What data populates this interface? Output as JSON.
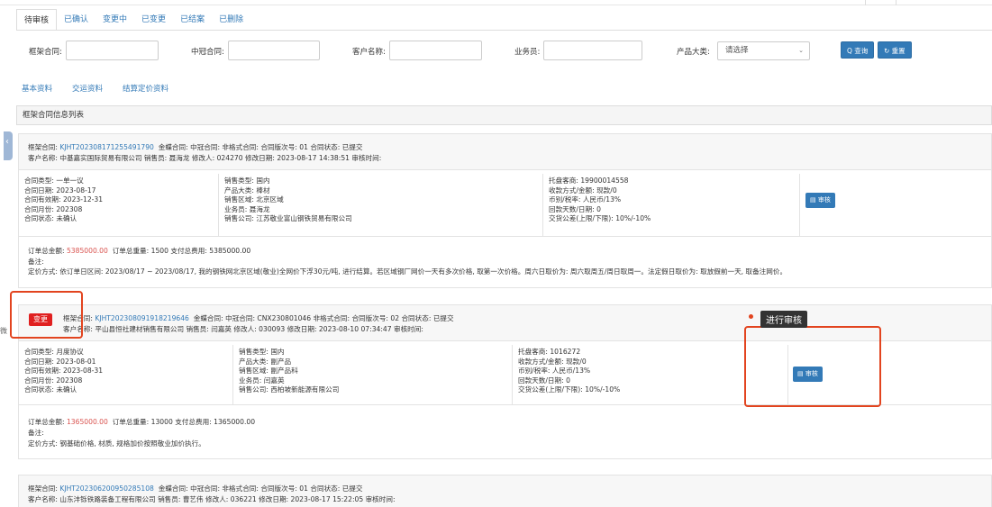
{
  "tabs": [
    "待审核",
    "已确认",
    "变更中",
    "已变更",
    "已结案",
    "已删除"
  ],
  "search": {
    "frame_label": "框架合同:",
    "zg_label": "中冠合同:",
    "customer_label": "客户名称:",
    "salesman_label": "业务员:",
    "category_label": "产品大类:",
    "category_value": "请选择",
    "query_label": "Q 查询",
    "reset_label": "↻ 重置"
  },
  "subtabs": [
    "基本资料",
    "交运资料",
    "结算定价资料"
  ],
  "panel_title": "框架合同信息列表",
  "side_char": "微",
  "tooltip": "进行审核",
  "badge": "变更",
  "audit_label": "审核",
  "contracts": [
    {
      "head1_pre": "框架合同:",
      "frame_no": "KJHT202308171255491790",
      "head1_rest": "金蝶合同:    中冠合同:    非格式合同:    合同版次号: 01   合同状态: 已提交",
      "head2": "客户名称: 中基嘉实国际贸易有限公司   销售员: 聂海龙   修改人: 024270   修改日期: 2023-08-17 14:38:51   审核时间:",
      "col1": [
        "合同类型: 一单一议",
        "合同日期: 2023-08-17",
        "合同有效期: 2023-12-31",
        "合同月份: 202308",
        "合同状态: 未确认"
      ],
      "col2": [
        "销售类型: 国内",
        "产品大类: 棒材",
        "销售区域: 北京区域",
        "业务员: 聂海龙",
        "销售公司: 江苏敬业富山钢铁贸易有限公司"
      ],
      "col3": [
        "托盘客商: 19900014558",
        "收款方式/金额: 现款/0",
        "币别/税率: 人民币/13%",
        "回款天数/日期: 0",
        "交货公差(上限/下限): 10%/-10%"
      ],
      "amount_label": "订单总金额:",
      "amount": "5385000.00",
      "amount_rest": "订单总重量: 1500   支付总费用: 5385000.00",
      "remark": "备注:",
      "pricing": "定价方式: 依订单日区间: 2023/08/17 ~ 2023/08/17, 我的钢铁网北京区域(敬业)全网价下浮30元/吨, 进行结算。若区域钢厂网价一天有多次价格, 取第一次价格。周六日取价为: 周六取周五/周日取周一。法定假日取价为: 取放假前一天, 取备注网价。"
    },
    {
      "head1_pre": "框架合同:",
      "frame_no": "KJHT202308091918219646",
      "head1_rest": "金蝶合同:    中冠合同: CNX230801046   非格式合同:    合同版次号: 02   合同状态: 已提交",
      "head2": "客户名称: 平山县恒社建材销售有限公司   销售员: 闫嘉英   修改人: 030093   修改日期: 2023-08-10 07:34:47   审核时间:",
      "col1": [
        "合同类型: 月度协议",
        "合同日期: 2023-08-01",
        "合同有效期: 2023-08-31",
        "合同月份: 202308",
        "合同状态: 未确认"
      ],
      "col2": [
        "销售类型: 国内",
        "产品大类: 副产品",
        "销售区域: 副产品科",
        "业务员: 闫嘉英",
        "销售公司: 西柏坡新能源有限公司"
      ],
      "col3": [
        "托盘客商: 1016272",
        "收款方式/金额: 现款/0",
        "币别/税率: 人民币/13%",
        "回款天数/日期: 0",
        "交货公差(上限/下限): 10%/-10%"
      ],
      "amount_label": "订单总金额:",
      "amount": "1365000.00",
      "amount_rest": "订单总重量: 13000   支付总费用: 1365000.00",
      "remark": "备注:",
      "pricing": "定价方式: 钢基础价格, 材质, 规格加价按照敬业加价执行。"
    },
    {
      "head1_pre": "框架合同:",
      "frame_no": "KJHT202306200950285108",
      "head1_rest": "金蝶合同:    中冠合同:    非格式合同:    合同版次号: 01   合同状态: 已提交",
      "head2": "客户名称: 山东沣铄铁路装备工程有限公司   销售员: 曹艺伟   修改人: 036221   修改日期: 2023-08-17 15:22:05   审核时间:"
    }
  ],
  "colors": {
    "link": "#337ab7",
    "danger": "#e02020",
    "annotation": "#e2441f"
  }
}
